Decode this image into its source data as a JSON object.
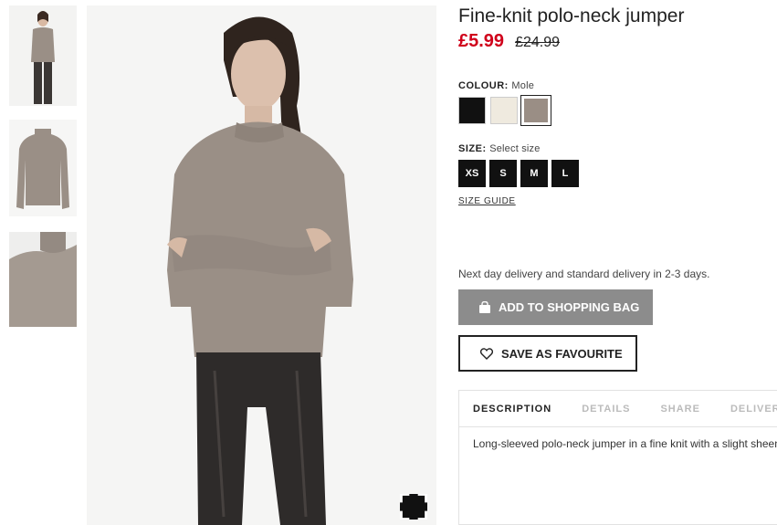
{
  "thumbnails": [
    {
      "alt": "model-wearing-jumper-thumbnail"
    },
    {
      "alt": "jumper-flat-thumbnail"
    },
    {
      "alt": "collar-detail-thumbnail"
    }
  ],
  "product": {
    "title": "Fine-knit polo-neck jumper",
    "price_current": "£5.99",
    "price_original": "£24.99"
  },
  "colour": {
    "label": "COLOUR:",
    "selected": "Mole",
    "options": [
      {
        "name": "Black",
        "hex": "#111111"
      },
      {
        "name": "Cream",
        "hex": "#efeadf"
      },
      {
        "name": "Mole",
        "hex": "#9a8e85"
      }
    ]
  },
  "size": {
    "label": "SIZE:",
    "selected": "Select size",
    "options": [
      "XS",
      "S",
      "M",
      "L"
    ],
    "guide_label": "SIZE GUIDE"
  },
  "delivery_text": "Next day delivery and standard delivery in 2-3 days.",
  "buttons": {
    "add_to_bag": "ADD TO SHOPPING BAG",
    "save_favourite": "SAVE AS FAVOURITE"
  },
  "tabs": [
    "DESCRIPTION",
    "DETAILS",
    "SHARE",
    "DELIVERY"
  ],
  "description": "Long-sleeved polo-neck jumper in a fine knit with a slight sheen.",
  "colors": {
    "price_red": "#d0021b",
    "button_grey": "#8c8c8c",
    "jumper": "#9a8f86"
  }
}
